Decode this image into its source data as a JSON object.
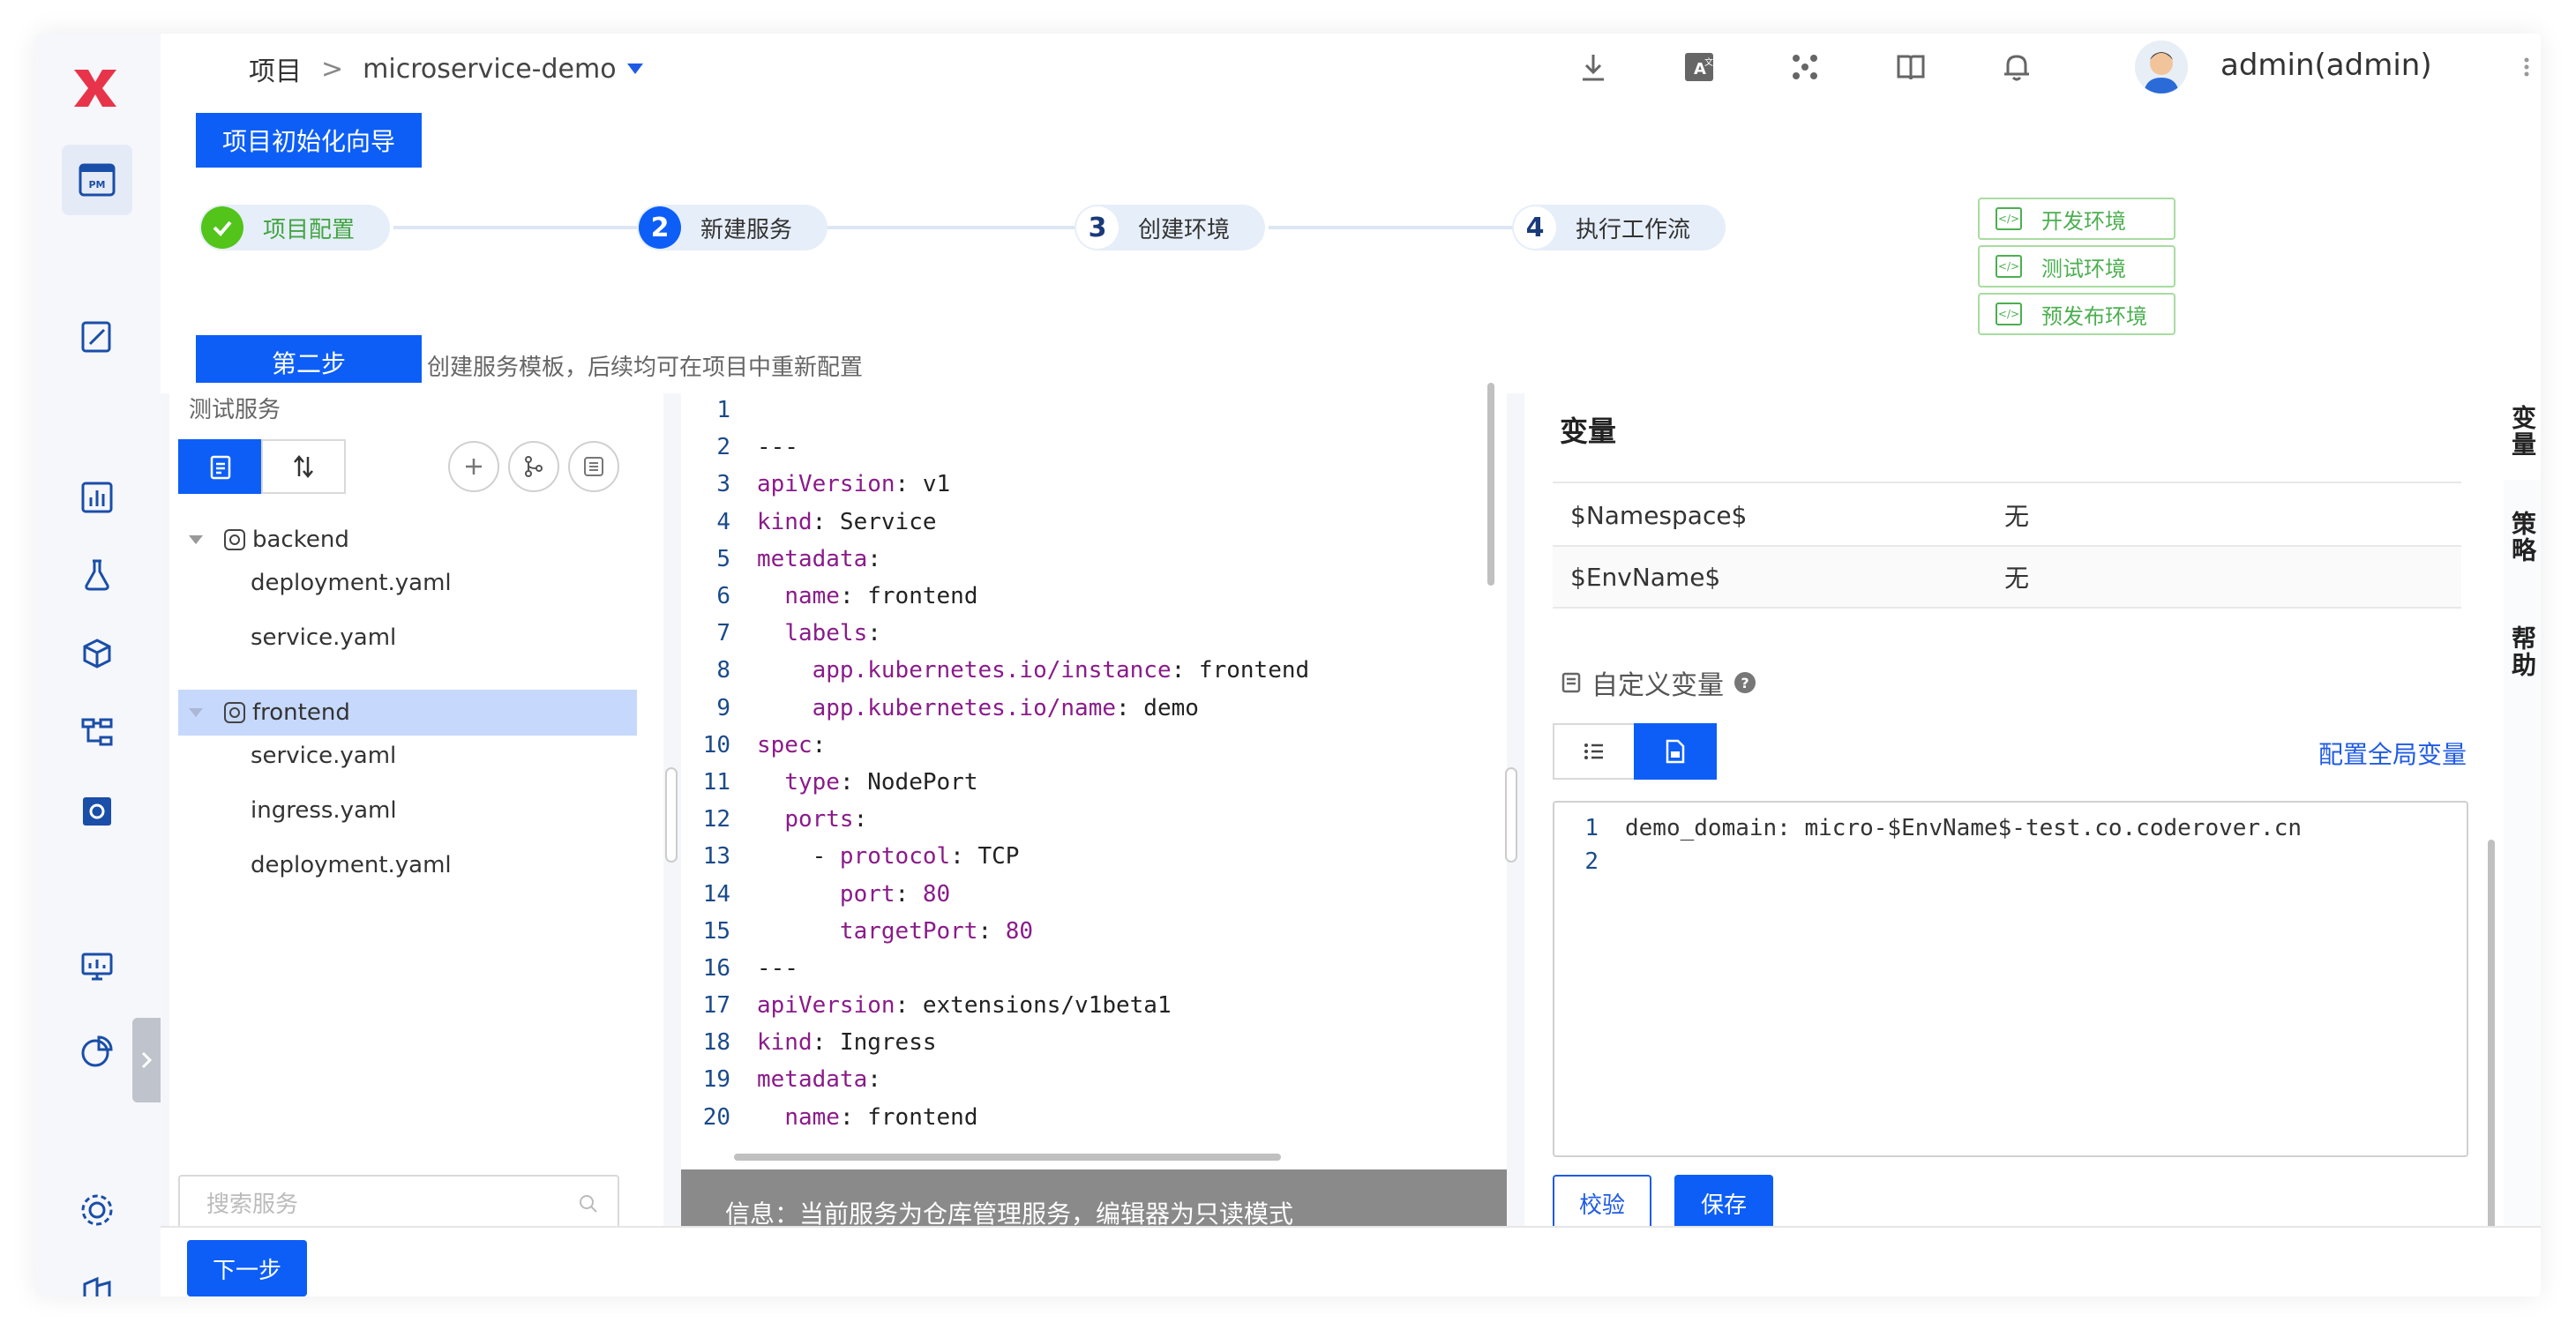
{
  "colors": {
    "primary": "#0d5ef7",
    "success": "#52c41a",
    "env_tag": "#4caf50",
    "info_bar": "#8a8a8a",
    "selected_row": "#c6d8fb"
  },
  "topbar": {
    "breadcrumb_root": "项目",
    "breadcrumb_sep": ">",
    "project_name": "microservice-demo",
    "username": "admin(admin)",
    "icons": [
      "download-icon",
      "translate-icon",
      "network-icon",
      "book-icon",
      "bell-icon"
    ]
  },
  "rail": {
    "icons": [
      "project-icon",
      "edit-icon",
      "dashboard-icon",
      "test-flask-icon",
      "package-icon",
      "workflow-icon",
      "settings-box-icon",
      "monitor-icon",
      "pie-chart-icon",
      "gear-icon",
      "building-icon"
    ]
  },
  "header": {
    "wizard_button": "项目初始化向导",
    "steps": [
      {
        "num": "1",
        "label": "项目配置",
        "state": "done"
      },
      {
        "num": "2",
        "label": "新建服务",
        "state": "active"
      },
      {
        "num": "3",
        "label": "创建环境",
        "state": "pending"
      },
      {
        "num": "4",
        "label": "执行工作流",
        "state": "pending"
      }
    ],
    "envs": [
      "开发环境",
      "测试环境",
      "预发布环境"
    ],
    "step_label": "第二步",
    "step_desc": "创建服务模板，后续均可在项目中重新配置"
  },
  "services": {
    "title": "测试服务",
    "search_placeholder": "搜索服务",
    "tree": [
      {
        "name": "backend",
        "files": [
          "deployment.yaml",
          "service.yaml"
        ]
      },
      {
        "name": "frontend",
        "files": [
          "service.yaml",
          "ingress.yaml",
          "deployment.yaml"
        ]
      }
    ]
  },
  "editor": {
    "lines": [
      {
        "no": "1",
        "parts": []
      },
      {
        "no": "2",
        "parts": [
          [
            "v",
            "---"
          ]
        ]
      },
      {
        "no": "3",
        "parts": [
          [
            "k",
            "apiVersion"
          ],
          [
            "v",
            ": v1"
          ]
        ]
      },
      {
        "no": "4",
        "parts": [
          [
            "k",
            "kind"
          ],
          [
            "v",
            ": Service"
          ]
        ]
      },
      {
        "no": "5",
        "parts": [
          [
            "k",
            "metadata"
          ],
          [
            "v",
            ":"
          ]
        ]
      },
      {
        "no": "6",
        "parts": [
          [
            "v",
            "  "
          ],
          [
            "k",
            "name"
          ],
          [
            "v",
            ": frontend"
          ]
        ]
      },
      {
        "no": "7",
        "parts": [
          [
            "v",
            "  "
          ],
          [
            "k",
            "labels"
          ],
          [
            "v",
            ":"
          ]
        ]
      },
      {
        "no": "8",
        "parts": [
          [
            "v",
            "    "
          ],
          [
            "k",
            "app.kubernetes.io/instance"
          ],
          [
            "v",
            ": frontend"
          ]
        ]
      },
      {
        "no": "9",
        "parts": [
          [
            "v",
            "    "
          ],
          [
            "k",
            "app.kubernetes.io/name"
          ],
          [
            "v",
            ": demo"
          ]
        ]
      },
      {
        "no": "10",
        "parts": [
          [
            "k",
            "spec"
          ],
          [
            "v",
            ":"
          ]
        ]
      },
      {
        "no": "11",
        "parts": [
          [
            "v",
            "  "
          ],
          [
            "k",
            "type"
          ],
          [
            "v",
            ": NodePort"
          ]
        ]
      },
      {
        "no": "12",
        "parts": [
          [
            "v",
            "  "
          ],
          [
            "k",
            "ports"
          ],
          [
            "v",
            ":"
          ]
        ]
      },
      {
        "no": "13",
        "parts": [
          [
            "v",
            "    - "
          ],
          [
            "k",
            "protocol"
          ],
          [
            "v",
            ": TCP"
          ]
        ]
      },
      {
        "no": "14",
        "parts": [
          [
            "v",
            "      "
          ],
          [
            "k",
            "port"
          ],
          [
            "v",
            ": "
          ],
          [
            "n",
            "80"
          ]
        ]
      },
      {
        "no": "15",
        "parts": [
          [
            "v",
            "      "
          ],
          [
            "k",
            "targetPort"
          ],
          [
            "v",
            ": "
          ],
          [
            "n",
            "80"
          ]
        ]
      },
      {
        "no": "16",
        "parts": [
          [
            "v",
            "---"
          ]
        ]
      },
      {
        "no": "17",
        "parts": [
          [
            "k",
            "apiVersion"
          ],
          [
            "v",
            ": extensions/v1beta1"
          ]
        ]
      },
      {
        "no": "18",
        "parts": [
          [
            "k",
            "kind"
          ],
          [
            "v",
            ": Ingress"
          ]
        ]
      },
      {
        "no": "19",
        "parts": [
          [
            "k",
            "metadata"
          ],
          [
            "v",
            ":"
          ]
        ]
      },
      {
        "no": "20",
        "parts": [
          [
            "v",
            "  "
          ],
          [
            "k",
            "name"
          ],
          [
            "v",
            ": frontend"
          ]
        ]
      }
    ],
    "info": "信息：当前服务为仓库管理服务，编辑器为只读模式"
  },
  "variables": {
    "title": "变量",
    "system_vars": [
      {
        "name": "$Namespace$",
        "value": "无"
      },
      {
        "name": "$EnvName$",
        "value": "无"
      }
    ],
    "custom_label": "自定义变量",
    "global_link": "配置全局变量",
    "yaml_lines": [
      {
        "no": "1",
        "text": "demo_domain: micro-$EnvName$-test.co.coderover.cn"
      },
      {
        "no": "2",
        "text": ""
      }
    ],
    "validate_button": "校验",
    "save_button": "保存"
  },
  "side_tabs": [
    "变量",
    "策略",
    "帮助"
  ],
  "footer": {
    "next_button": "下一步"
  }
}
